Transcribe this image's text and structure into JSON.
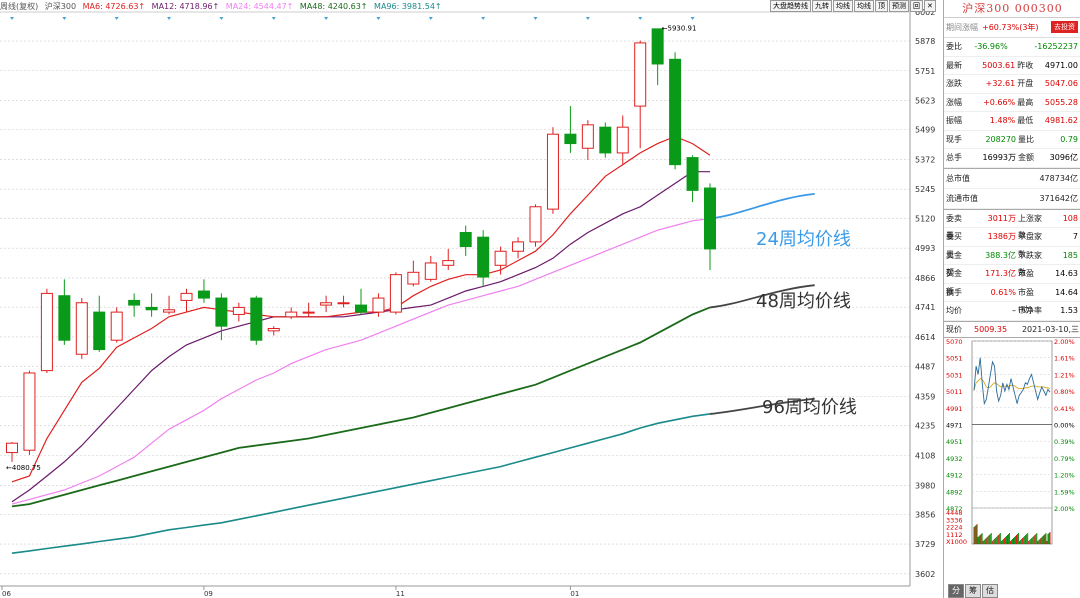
{
  "legend": {
    "prefix": "周线(复权)",
    "name": "沪深300",
    "ma6": "MA6: 4726.63↑",
    "ma12": "MA12: 4718.96↑",
    "ma24": "MA24: 4544.47↑",
    "ma48": "MA48: 4240.63↑",
    "ma96": "MA96: 3981.54↑"
  },
  "toolbar": [
    "大盘趋势线",
    "九转",
    "均线",
    "均线",
    "顶",
    "预测",
    "回",
    "✕"
  ],
  "annotations": {
    "high": "5930.91",
    "low": "4080.75",
    "ma24": "24周均价线",
    "ma48": "48周均价线",
    "ma96": "96周均价线"
  },
  "colors": {
    "up": "#e02020",
    "down": "#0a9a1a",
    "ma6": "#e02020",
    "ma12": "#6a1a6a",
    "ma24": "#f080f0",
    "ma48": "#1a6a1a",
    "ma96": "#1a8a8a",
    "ext24": "#3b9ae8",
    "ext48": "#444444",
    "ext96": "#444444"
  },
  "chart_data": {
    "type": "candlestick",
    "title": "沪深300",
    "period": "weekly",
    "ylim": [
      3550,
      6002
    ],
    "y_ticks": [
      "6002",
      "5878",
      "5751",
      "5623",
      "5499",
      "5372",
      "5245",
      "5120",
      "4993",
      "4866",
      "4741",
      "4614",
      "4487",
      "4359",
      "4235",
      "4108",
      "3980",
      "3856",
      "3729",
      "3602"
    ],
    "x_ticks": [
      "06",
      "09",
      "11",
      "01"
    ],
    "candles": [
      {
        "o": 4120,
        "c": 4160,
        "h": 4165,
        "l": 4080
      },
      {
        "o": 4130,
        "c": 4460,
        "h": 4470,
        "l": 4110
      },
      {
        "o": 4470,
        "c": 4800,
        "h": 4820,
        "l": 4460
      },
      {
        "o": 4790,
        "c": 4600,
        "h": 4860,
        "l": 4580
      },
      {
        "o": 4540,
        "c": 4760,
        "h": 4780,
        "l": 4520
      },
      {
        "o": 4720,
        "c": 4560,
        "h": 4790,
        "l": 4550
      },
      {
        "o": 4600,
        "c": 4720,
        "h": 4740,
        "l": 4590
      },
      {
        "o": 4770,
        "c": 4750,
        "h": 4800,
        "l": 4700
      },
      {
        "o": 4740,
        "c": 4730,
        "h": 4800,
        "l": 4700
      },
      {
        "o": 4720,
        "c": 4730,
        "h": 4790,
        "l": 4710
      },
      {
        "o": 4770,
        "c": 4800,
        "h": 4820,
        "l": 4720
      },
      {
        "o": 4810,
        "c": 4780,
        "h": 4860,
        "l": 4760
      },
      {
        "o": 4780,
        "c": 4660,
        "h": 4800,
        "l": 4600
      },
      {
        "o": 4710,
        "c": 4740,
        "h": 4760,
        "l": 4680
      },
      {
        "o": 4780,
        "c": 4600,
        "h": 4790,
        "l": 4580
      },
      {
        "o": 4640,
        "c": 4650,
        "h": 4660,
        "l": 4620
      },
      {
        "o": 4700,
        "c": 4720,
        "h": 4740,
        "l": 4690
      },
      {
        "o": 4720,
        "c": 4720,
        "h": 4760,
        "l": 4700
      },
      {
        "o": 4750,
        "c": 4760,
        "h": 4790,
        "l": 4720
      },
      {
        "o": 4760,
        "c": 4760,
        "h": 4790,
        "l": 4740
      },
      {
        "o": 4750,
        "c": 4720,
        "h": 4820,
        "l": 4710
      },
      {
        "o": 4720,
        "c": 4780,
        "h": 4800,
        "l": 4700
      },
      {
        "o": 4720,
        "c": 4880,
        "h": 4890,
        "l": 4710
      },
      {
        "o": 4840,
        "c": 4890,
        "h": 4940,
        "l": 4830
      },
      {
        "o": 4860,
        "c": 4930,
        "h": 4960,
        "l": 4850
      },
      {
        "o": 4920,
        "c": 4940,
        "h": 4990,
        "l": 4900
      },
      {
        "o": 5060,
        "c": 5000,
        "h": 5090,
        "l": 4960
      },
      {
        "o": 5040,
        "c": 4870,
        "h": 5070,
        "l": 4830
      },
      {
        "o": 4920,
        "c": 4980,
        "h": 5000,
        "l": 4880
      },
      {
        "o": 4980,
        "c": 5020,
        "h": 5040,
        "l": 4950
      },
      {
        "o": 5020,
        "c": 5170,
        "h": 5180,
        "l": 5000
      },
      {
        "o": 5160,
        "c": 5480,
        "h": 5510,
        "l": 5140
      },
      {
        "o": 5480,
        "c": 5440,
        "h": 5600,
        "l": 5400
      },
      {
        "o": 5420,
        "c": 5520,
        "h": 5540,
        "l": 5370
      },
      {
        "o": 5510,
        "c": 5400,
        "h": 5530,
        "l": 5380
      },
      {
        "o": 5400,
        "c": 5510,
        "h": 5560,
        "l": 5350
      },
      {
        "o": 5600,
        "c": 5870,
        "h": 5880,
        "l": 5420
      },
      {
        "o": 5930,
        "c": 5780,
        "h": 5931,
        "l": 5690
      },
      {
        "o": 5800,
        "c": 5350,
        "h": 5830,
        "l": 5330
      },
      {
        "o": 5380,
        "c": 5240,
        "h": 5390,
        "l": 5190
      },
      {
        "o": 5250,
        "c": 4990,
        "h": 5270,
        "l": 4900
      }
    ],
    "ma6": [
      3995,
      4020,
      4180,
      4300,
      4420,
      4480,
      4570,
      4610,
      4650,
      4700,
      4720,
      4740,
      4730,
      4720,
      4710,
      4700,
      4700,
      4700,
      4700,
      4710,
      4720,
      4720,
      4740,
      4790,
      4830,
      4860,
      4880,
      4880,
      4900,
      4940,
      4980,
      5050,
      5140,
      5220,
      5300,
      5350,
      5400,
      5440,
      5470,
      5440,
      5390
    ],
    "ma12": [
      3910,
      3960,
      4020,
      4080,
      4150,
      4230,
      4310,
      4390,
      4470,
      4530,
      4580,
      4610,
      4640,
      4660,
      4680,
      4700,
      4700,
      4700,
      4700,
      4700,
      4710,
      4720,
      4730,
      4740,
      4750,
      4780,
      4810,
      4830,
      4850,
      4880,
      4910,
      4950,
      5010,
      5060,
      5100,
      5140,
      5170,
      5220,
      5270,
      5320,
      5320
    ],
    "ma24": [
      3900,
      3920,
      3940,
      3960,
      3990,
      4020,
      4060,
      4100,
      4160,
      4220,
      4260,
      4300,
      4350,
      4390,
      4430,
      4460,
      4500,
      4530,
      4560,
      4580,
      4600,
      4630,
      4660,
      4690,
      4720,
      4750,
      4770,
      4790,
      4810,
      4830,
      4860,
      4890,
      4920,
      4950,
      4980,
      5010,
      5040,
      5070,
      5090,
      5110,
      5120
    ],
    "ma48": [
      3890,
      3900,
      3920,
      3940,
      3960,
      3980,
      4000,
      4020,
      4040,
      4060,
      4080,
      4100,
      4120,
      4140,
      4150,
      4160,
      4170,
      4180,
      4195,
      4210,
      4225,
      4240,
      4255,
      4270,
      4290,
      4310,
      4330,
      4350,
      4370,
      4390,
      4410,
      4440,
      4470,
      4500,
      4530,
      4560,
      4590,
      4630,
      4670,
      4710,
      4740
    ],
    "ma96": [
      3690,
      3700,
      3710,
      3720,
      3730,
      3740,
      3750,
      3760,
      3775,
      3790,
      3800,
      3810,
      3820,
      3835,
      3850,
      3865,
      3880,
      3895,
      3910,
      3925,
      3940,
      3955,
      3970,
      3985,
      4000,
      4015,
      4030,
      4045,
      4060,
      4080,
      4100,
      4120,
      4140,
      4160,
      4180,
      4200,
      4225,
      4245,
      4260,
      4275,
      4285
    ]
  },
  "panel": {
    "title": "沪深300  000300",
    "change_label": "期间涨幅",
    "change_value": "+60.73%(3年)",
    "button": "去投资",
    "rows": [
      {
        "l1": "委比",
        "v1": "-36.96%",
        "c1": "green",
        "l2": "",
        "v2": "-16252237",
        "c2": "green"
      },
      {
        "l1": "最新",
        "v1": "5003.61",
        "c1": "red",
        "l2": "昨收",
        "v2": "4971.00",
        "c2": "blk"
      },
      {
        "l1": "涨跌",
        "v1": "+32.61",
        "c1": "red",
        "l2": "开盘",
        "v2": "5047.06",
        "c2": "red"
      },
      {
        "l1": "涨幅",
        "v1": "+0.66%",
        "c1": "red",
        "l2": "最高",
        "v2": "5055.28",
        "c2": "red"
      },
      {
        "l1": "振幅",
        "v1": "1.48%",
        "c1": "red",
        "l2": "最低",
        "v2": "4981.62",
        "c2": "red"
      },
      {
        "l1": "现手",
        "v1": "208270",
        "c1": "green",
        "l2": "量比",
        "v2": "0.79",
        "c2": "green"
      },
      {
        "l1": "总手",
        "v1": "16993万",
        "c1": "blk",
        "l2": "金额",
        "v2": "3096亿",
        "c2": "blk"
      }
    ],
    "wide": [
      {
        "l": "总市值",
        "v": "478734亿"
      },
      {
        "l": "流通市值",
        "v": "371642亿"
      }
    ],
    "rows2": [
      {
        "l1": "委卖量",
        "v1": "3011万",
        "c1": "red",
        "l2": "上涨家数",
        "v2": "108",
        "c2": "red"
      },
      {
        "l1": "委买量",
        "v1": "1386万",
        "c1": "red",
        "l2": "平盘家数",
        "v2": "7",
        "c2": "blk"
      },
      {
        "l1": "卖金额",
        "v1": "388.3亿",
        "c1": "green",
        "l2": "下跌家数",
        "v2": "185",
        "c2": "green"
      },
      {
        "l1": "买金额",
        "v1": "171.3亿",
        "c1": "red",
        "l2": "市盈",
        "v2": "14.63",
        "c2": "blk"
      },
      {
        "l1": "换手",
        "v1": "0.61%",
        "c1": "red",
        "l2": "市盈(动)",
        "v2": "14.64",
        "c2": "blk"
      },
      {
        "l1": "均价",
        "v1": "–",
        "c1": "blk",
        "l2": "市净率",
        "v2": "1.53",
        "c2": "blk"
      }
    ],
    "mini": {
      "label": "现价",
      "price": "5009.35",
      "date": "2021-03-10,三",
      "left_ticks": [
        "5070",
        "5051",
        "5031",
        "5011",
        "4991",
        "4971",
        "4951",
        "4932",
        "4912",
        "4892",
        "4872",
        "4448",
        "3336",
        "2224",
        "1112",
        "X1000"
      ],
      "right_ticks": [
        "2.00%",
        "1.61%",
        "1.21%",
        "0.80%",
        "0.41%",
        "0.00%",
        "0.39%",
        "0.79%",
        "1.20%",
        "1.59%",
        "2.00%"
      ],
      "price_line": [
        5011,
        5040,
        5030,
        5050,
        5020,
        4995,
        5000,
        5015,
        5030,
        5045,
        5040,
        5010,
        4998,
        5005,
        5020,
        5010,
        5018,
        5012,
        5025,
        5015,
        5005,
        4995,
        5005,
        5008,
        5012,
        5020,
        5018,
        5025,
        5030,
        5020,
        5010,
        5000,
        5008,
        5015,
        5010,
        5005,
        5012,
        5009
      ],
      "avg_line": [
        5011,
        5020,
        5022,
        5025,
        5024,
        5020,
        5015,
        5014,
        5015,
        5018,
        5020,
        5019,
        5017,
        5015,
        5016,
        5016,
        5016,
        5016,
        5017,
        5017,
        5016,
        5014,
        5013,
        5013,
        5013,
        5014,
        5014,
        5015,
        5016,
        5016,
        5016,
        5015,
        5015,
        5015,
        5015,
        5014,
        5014,
        5013
      ]
    },
    "tabs": [
      "分",
      "筹",
      "估"
    ]
  }
}
